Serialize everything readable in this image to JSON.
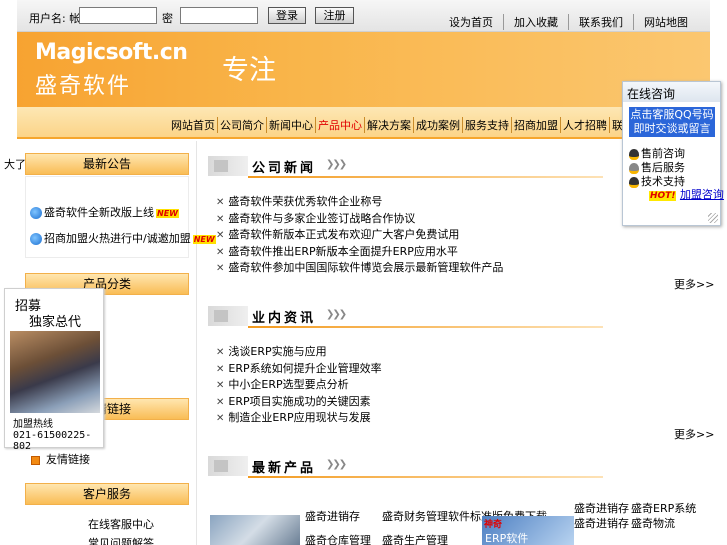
{
  "topbar": {
    "login_label": "用户名: 帐",
    "pwd_label": "密",
    "login_btn": "登录",
    "register_btn": "注册",
    "links": [
      "设为首页",
      "加入收藏",
      "联系我们",
      "网站地图"
    ]
  },
  "banner": {
    "logo_en": "Magicsoft.cn",
    "logo_cn": "盛奇软件",
    "slogan": "专注"
  },
  "nav": {
    "items": [
      "网站首页",
      "公司简介",
      "新闻中心",
      "产品中心",
      "解决方案",
      "成功案例",
      "服务支持",
      "招商加盟",
      "人才招聘",
      "联系我们"
    ],
    "active_index": 3
  },
  "left_mark": "大了",
  "sidebar": {
    "box1_title": "最新公告",
    "box1_items": [
      "盛奇软件全新改版上线",
      "招商加盟火热进行中/诚邀加盟"
    ],
    "box1_new_tag": "NEW",
    "box2_title": "产品分类",
    "box3_title": "友情链接",
    "box3_item": "友情链接",
    "box4_title": "客户服务",
    "box4_items": [
      "在线客服中心",
      "常见问题解答"
    ]
  },
  "ad": {
    "line1": "招募",
    "line2": "独家总代",
    "hotline_label": "加盟热线",
    "phone": "021-61500225-802"
  },
  "main": {
    "company_news_title": "公司新闻",
    "company_news": [
      "盛奇软件荣获优秀软件企业称号",
      "盛奇软件与多家企业签订战略合作协议",
      "盛奇软件新版本正式发布欢迎广大客户免费试用",
      "盛奇软件推出ERP新版本全面提升ERP应用水平",
      "盛奇软件参加中国国际软件博览会展示最新管理软件产品"
    ],
    "industry_title": "业内资讯",
    "industry_news": [
      "浅谈ERP实施与应用",
      "ERP系统如何提升企业管理效率",
      "中小企ERP选型要点分析",
      "ERP项目实施成功的关键因素",
      "制造企业ERP应用现状与发展"
    ],
    "more_label": "更多>>",
    "products_title": "最新产品",
    "products": [
      [
        "盛奇进销存",
        "盛奇财务管理软件标准版免费下载"
      ],
      [
        "盛奇仓库管理",
        "盛奇生产管理"
      ]
    ],
    "products_right": [
      [
        "盛奇进销存",
        "盛奇ERP系统"
      ],
      [
        "盛奇进销存",
        "盛奇物流"
      ]
    ],
    "erp_tag": "神奇",
    "erp_label": "ERP软件"
  },
  "consult": {
    "title": "在线咨询",
    "banner_line1": "点击客服QQ号码",
    "banner_line2": "即时交谈或留言",
    "contacts": [
      "售前咨询",
      "售后服务",
      "技术支持"
    ],
    "hot_tag": "HOT!",
    "hot_link": "加盟咨询"
  },
  "colors": {
    "banner_orange": "#f7a331",
    "nav_active": "#e00000",
    "consult_blue": "#2b66d9"
  }
}
